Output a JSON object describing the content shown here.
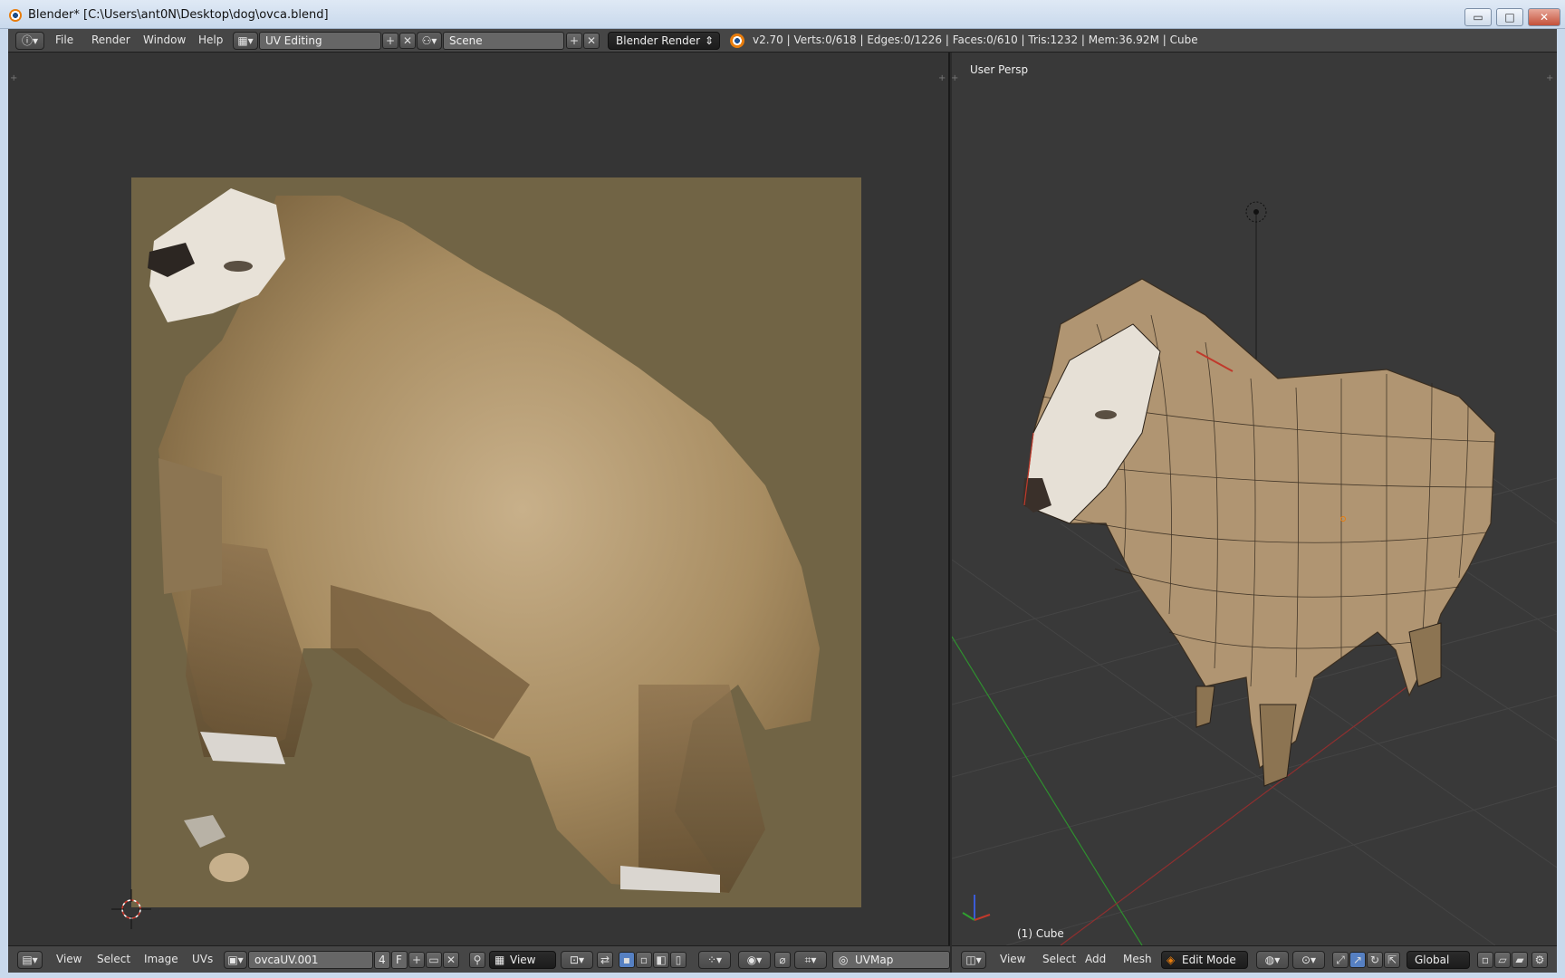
{
  "window": {
    "title": "Blender* [C:\\Users\\ant0N\\Desktop\\dog\\ovca.blend]",
    "min_glyph": "▭",
    "max_glyph": "□",
    "close_glyph": "✕"
  },
  "info_header": {
    "menus": [
      "File",
      "Render",
      "Window",
      "Help"
    ],
    "screen_layout": "UV Editing",
    "scene": "Scene",
    "render_engine": "Blender Render",
    "stats": "v2.70 | Verts:0/618 | Edges:0/1226 | Faces:0/610 | Tris:1232 | Mem:36.92M | Cube"
  },
  "uv_editor": {
    "header": {
      "menus": [
        "View",
        "Select",
        "Image",
        "UVs"
      ],
      "image_name": "ovcaUV.001",
      "users_count": "4",
      "fake_user": "F",
      "view_mode": "View",
      "uv_map": "UVMap"
    }
  },
  "view3d": {
    "view_label": "User Persp",
    "object_label": "(1) Cube",
    "header": {
      "menus": [
        "View",
        "Select",
        "Add",
        "Mesh"
      ],
      "mode": "Edit Mode",
      "orientation": "Global"
    }
  },
  "colors": {
    "uv_background": "#716445",
    "wool": "#b39a73",
    "face": "#e8e2d8",
    "editor_bg": "#353535",
    "viewport_bg": "#393939",
    "accent_orange": "#e87d0d"
  },
  "icons": [
    "blender-logo-icon",
    "info-editor-icon",
    "screen-layout-icon",
    "scene-icon",
    "render-engine-icon",
    "image-editor-icon",
    "image-browse-icon",
    "pin-icon",
    "uv-sync-icon",
    "pivot-icon",
    "proportional-edit-icon",
    "snap-icon",
    "view3d-editor-icon",
    "edit-mode-icon",
    "viewport-shading-icon",
    "manipulator-icon",
    "axis-gizmo-icon",
    "lamp-icon",
    "3d-cursor-icon"
  ]
}
